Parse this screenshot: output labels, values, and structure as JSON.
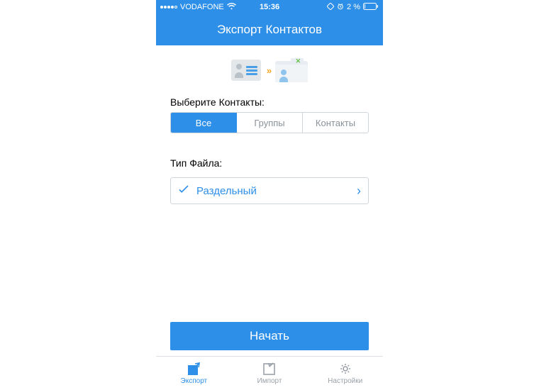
{
  "status_bar": {
    "carrier": "VODAFONE",
    "time": "15:36",
    "battery": "2 %"
  },
  "header": {
    "title": "Экспорт Контактов"
  },
  "contacts_section": {
    "label": "Выберите Контакты:",
    "segments": [
      "Все",
      "Группы",
      "Контакты"
    ]
  },
  "filetype_section": {
    "label": "Тип Файла:",
    "selected": "Раздельный"
  },
  "primary_action": "Начать",
  "tabbar": {
    "items": [
      "Экспорт",
      "Импорт",
      "Настройки"
    ]
  }
}
